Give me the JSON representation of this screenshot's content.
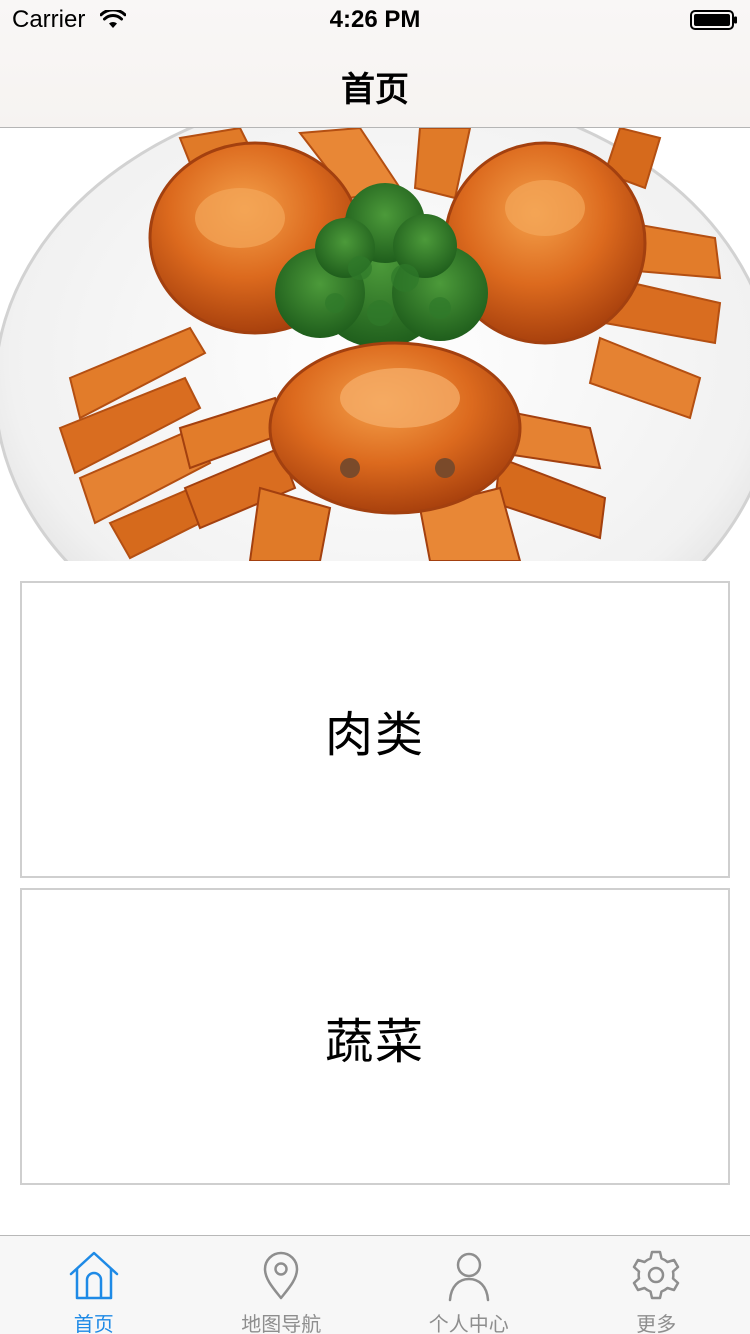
{
  "status_bar": {
    "carrier": "Carrier",
    "time": "4:26 PM"
  },
  "nav": {
    "title": "首页"
  },
  "hero": {
    "icon": "crab-dish-image"
  },
  "categories": [
    {
      "label": "肉类"
    },
    {
      "label": "蔬菜"
    }
  ],
  "tabbar": {
    "active_color": "#1e8ae6",
    "inactive_color": "#8e8e8e",
    "tabs": [
      {
        "label": "首页",
        "icon": "home-icon",
        "active": true
      },
      {
        "label": "地图导航",
        "icon": "map-pin-icon",
        "active": false
      },
      {
        "label": "个人中心",
        "icon": "person-icon",
        "active": false
      },
      {
        "label": "更多",
        "icon": "gear-icon",
        "active": false
      }
    ]
  }
}
